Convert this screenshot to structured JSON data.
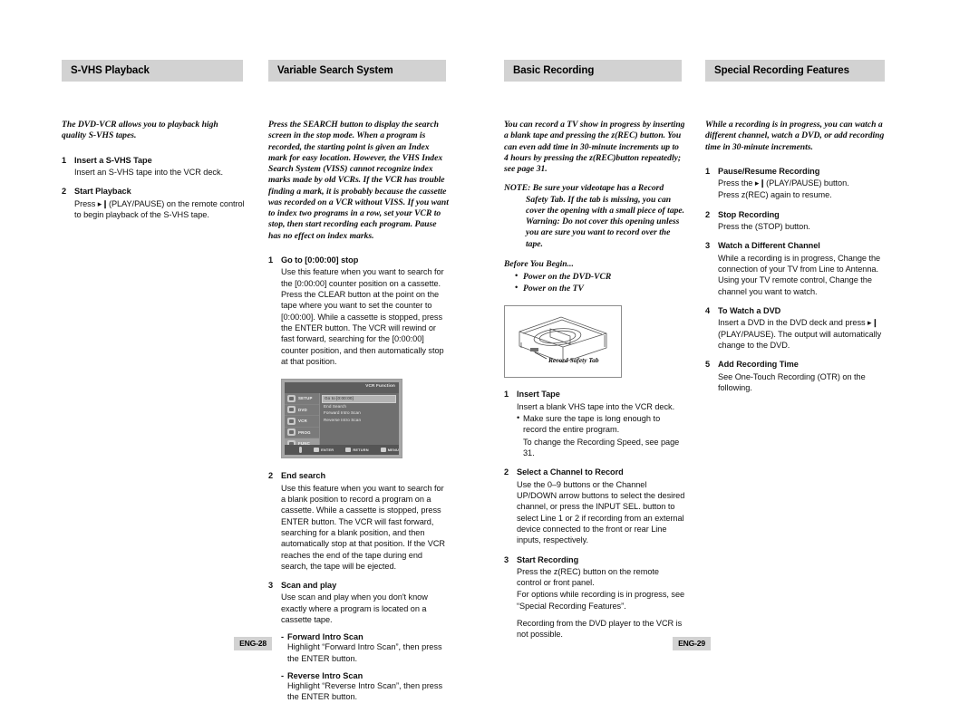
{
  "document": {
    "type": "instruction-manual-spread",
    "folio_left": "ENG-28",
    "folio_right": "ENG-29",
    "header_bg": "#d2d2d2"
  },
  "columns": [
    {
      "id": "col1",
      "heading": "S-VHS Playback",
      "intro": "The DVD-VCR allows you to playback high quality S-VHS tapes.",
      "steps": [
        {
          "num": "1",
          "title": "Insert a S-VHS Tape",
          "text": "Insert an S-VHS tape into the VCR deck."
        },
        {
          "num": "2",
          "title": "Start Playback",
          "text": "Press ▸❙(PLAY/PAUSE) on the remote control to begin playback of the S-VHS tape."
        }
      ]
    },
    {
      "id": "col2",
      "heading": "Variable Search System",
      "intro": "Press the SEARCH button to display the search screen in the stop mode. When a program is recorded, the starting point is given an Index mark for easy location. However, the VHS Index Search System (VISS) cannot recognize index marks made by old VCRs. If the VCR has trouble finding a mark, it is probably because the cassette was recorded on a VCR without VISS. If you want to index two programs in a row, set your VCR to stop, then start recording each program. Pause has no effect on index marks.",
      "steps": [
        {
          "num": "1",
          "title": "Go to [0:00:00] stop",
          "text": "Use this feature when you want to search for the [0:00:00] counter position on a cassette. Press the CLEAR button at the point on the tape where you want to set the counter to [0:00:00].  While a cassette is stopped, press the ENTER button. The VCR will rewind or fast forward, searching for the [0:00:00] counter position, and then automatically stop at that position."
        },
        {
          "num": "2",
          "title": "End search",
          "text": "Use this feature when you want to search for a blank position to record a program on a cassette. While a cassette is stopped, press ENTER button. The VCR will fast forward, searching for a blank position, and then automatically stop at that position. If the VCR reaches the end of the tape during end search, the tape will be ejected."
        },
        {
          "num": "3",
          "title": "Scan and play",
          "text": "Use scan and play when you don't know exactly where a program is located on a cassette tape.",
          "dash_items": [
            {
              "title": "Forward Intro Scan",
              "text": "Highlight “Forward Intro Scan”, then press the ENTER button."
            },
            {
              "title": "Reverse Intro Scan",
              "text": "Highlight “Reverse Intro Scan”, then press the ENTER button."
            }
          ]
        }
      ],
      "osd": {
        "title": "VCR Function",
        "sidebar": [
          {
            "label": "SETUP",
            "icon": "gear-icon",
            "active": false
          },
          {
            "label": "DVD",
            "icon": "disc-icon",
            "active": false
          },
          {
            "label": "VCR",
            "icon": "cassette-icon",
            "active": false
          },
          {
            "label": "PROG",
            "icon": "clock-icon",
            "active": false
          },
          {
            "label": "FUNC",
            "icon": "function-icon",
            "active": true
          }
        ],
        "menu_items": [
          {
            "label": "Go to [0:00:00]",
            "highlighted": true
          },
          {
            "label": "End Search",
            "highlighted": false
          },
          {
            "label": "Forward Intro Scan",
            "highlighted": false
          },
          {
            "label": "Reverse Intro Scan",
            "highlighted": false
          }
        ],
        "footer_keys": [
          "ENTER",
          "RETURN",
          "MENU"
        ]
      }
    },
    {
      "id": "col3",
      "heading": "Basic Recording",
      "intro": "You can record a TV show in progress by inserting a blank tape and pressing the  z(REC) button. You can even add time in 30-minute increments up to 4 hours by pressing the  z(REC)button repeatedly; see page 31.",
      "note_label": "NOTE:",
      "note_text": "Be sure your videotape has a Record Safety Tab. If the tab is missing, you can cover the opening with a small piece of tape. Warning: Do not cover this opening unless you are sure you want to record over the tape.",
      "before_you_begin": "Before You Begin...",
      "begin_bullets": [
        "Power on the DVD-VCR",
        "Power on the TV"
      ],
      "figure": {
        "name": "vhs-cassette-illustration",
        "caption": "Record Safety Tab"
      },
      "steps": [
        {
          "num": "1",
          "title": "Insert Tape",
          "text": "Insert a blank VHS tape into the VCR deck.",
          "bullet": "Make sure the tape is long enough to record the entire program.",
          "text2": "To change the Recording Speed, see page 31."
        },
        {
          "num": "2",
          "title": "Select a Channel to Record",
          "text": "Use the 0–9 buttons or the Channel UP/DOWN arrow buttons to select the desired channel, or press the INPUT SEL. button to select Line 1 or 2 if recording from an external device connected to the front or rear Line inputs, respectively."
        },
        {
          "num": "3",
          "title": "Start Recording",
          "text": "Press the  z(REC) button on the remote control or front panel.",
          "text2": "For options while recording is in progress, see “Special Recording Features”.",
          "text3": "Recording from the DVD player to the VCR is not possible."
        }
      ]
    },
    {
      "id": "col4",
      "heading": "Special Recording Features",
      "intro": "While a recording is in progress, you can watch a different channel, watch a DVD, or add recording time in 30-minute increments.",
      "steps": [
        {
          "num": "1",
          "title": "Pause/Resume Recording",
          "text": "Press the  ▸❙(PLAY/PAUSE) button.",
          "text2": "Press  z(REC) again to resume."
        },
        {
          "num": "2",
          "title": "Stop Recording",
          "text": "Press the      (STOP) button."
        },
        {
          "num": "3",
          "title": "Watch a Different Channel",
          "text": "While a recording is in progress, Change the connection of your TV from Line to Antenna. Using your TV remote control, Change the channel you want to watch."
        },
        {
          "num": "4",
          "title": "To Watch a DVD",
          "text": "Insert a DVD in the DVD deck and press ▸❙ (PLAY/PAUSE). The output will automatically change to the DVD."
        },
        {
          "num": "5",
          "title": "Add Recording Time",
          "text": "See One-Touch Recording (OTR) on the following."
        }
      ]
    }
  ]
}
